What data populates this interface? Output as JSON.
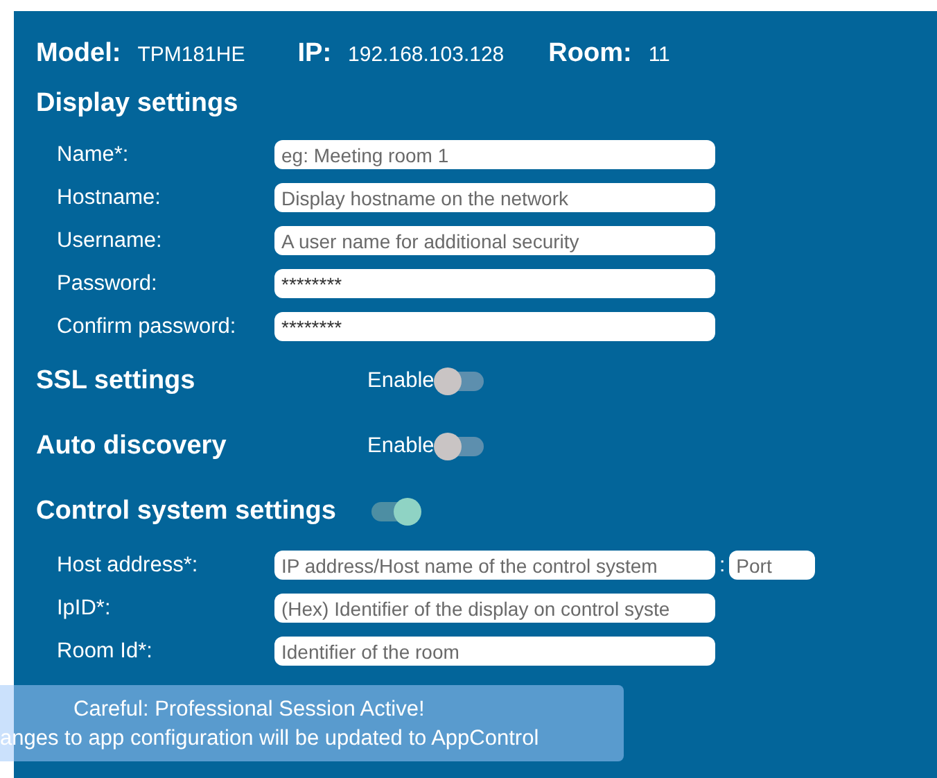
{
  "header": [
    {
      "label": "Model:",
      "value": "TPM181HE"
    },
    {
      "label": "IP:",
      "value": "192.168.103.128"
    },
    {
      "label": "Room:",
      "value": "11"
    }
  ],
  "display_settings": {
    "title": "Display settings",
    "fields": [
      {
        "label": "Name*:",
        "placeholder": "eg: Meeting room 1"
      },
      {
        "label": "Hostname:",
        "placeholder": "Display hostname on the network"
      },
      {
        "label": "Username:",
        "placeholder": "A user name for additional security"
      },
      {
        "label": "Password:",
        "value": "********"
      },
      {
        "label": "Confirm password:",
        "value": "********"
      }
    ]
  },
  "ssl_settings": {
    "title": "SSL settings",
    "toggle_label": "Enable",
    "on": false
  },
  "auto_discovery": {
    "title": "Auto discovery",
    "toggle_label": "Enable",
    "on": false
  },
  "control_system_settings": {
    "title": "Control system settings",
    "on": true,
    "fields": [
      {
        "label": "Host address*:",
        "placeholder": "IP address/Host name of the control system",
        "separator": ":",
        "port_placeholder": "Port"
      },
      {
        "label": "IpID*:",
        "placeholder": "(Hex) Identifier of the display on control syste"
      },
      {
        "label": "Room Id*:",
        "placeholder": "Identifier of the room"
      }
    ]
  },
  "toast": {
    "lines": [
      "Careful: Professional Session Active!",
      "anges to app configuration will be updated to AppControl"
    ]
  }
}
